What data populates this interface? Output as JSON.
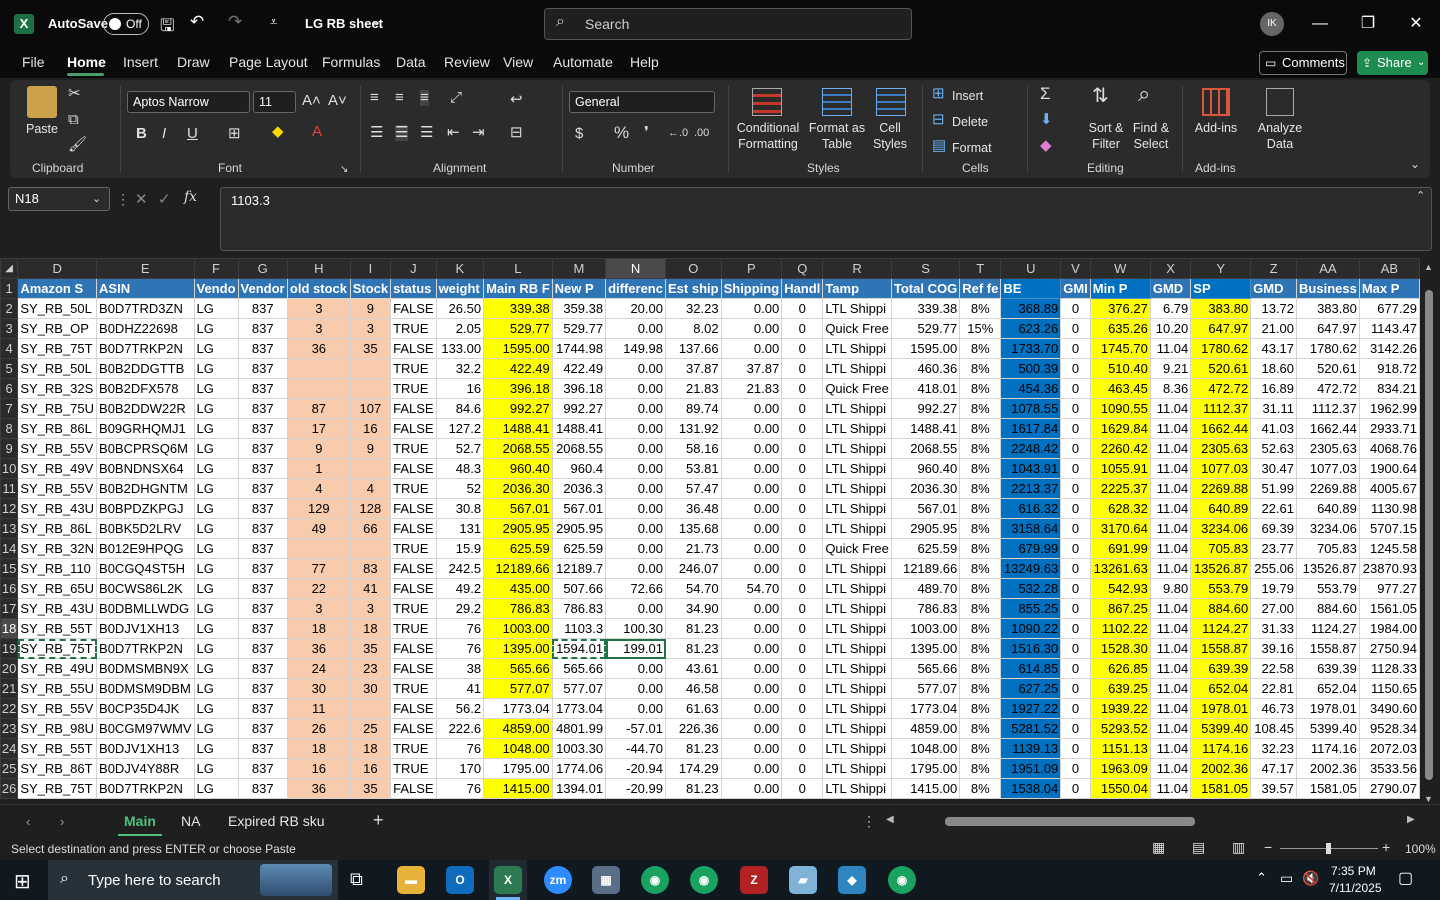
{
  "titlebar": {
    "app_icon": "excel-icon",
    "autosave_label": "AutoSave",
    "autosave_state": "Off",
    "file_name": "LG RB sheet",
    "search_placeholder": "Search",
    "avatar_initials": "IK"
  },
  "menu": [
    "File",
    "Home",
    "Insert",
    "Draw",
    "Page Layout",
    "Formulas",
    "Data",
    "Review",
    "View",
    "Automate",
    "Help"
  ],
  "menu_active": "Home",
  "buttons": {
    "comments": "Comments",
    "share": "Share"
  },
  "ribbon": {
    "clipboard": {
      "paste": "Paste",
      "label": "Clipboard"
    },
    "font": {
      "name": "Aptos Narrow",
      "size": "11",
      "label": "Font",
      "bold": "B",
      "italic": "I",
      "underline": "U"
    },
    "alignment": {
      "label": "Alignment"
    },
    "number": {
      "format": "General",
      "label": "Number",
      "currency": "$",
      "percent": "%"
    },
    "styles": {
      "conditional": "Conditional Formatting",
      "format_as_table": "Format as Table",
      "cell_styles": "Cell Styles",
      "label": "Styles"
    },
    "cells": {
      "insert": "Insert",
      "delete": "Delete",
      "format": "Format",
      "label": "Cells"
    },
    "editing": {
      "sort_filter": "Sort & Filter",
      "find_select": "Find & Select",
      "label": "Editing"
    },
    "addins": {
      "addins": "Add-ins",
      "analyze": "Analyze Data",
      "label": "Add-ins"
    }
  },
  "formula_bar": {
    "name_box": "N18",
    "fx": "fx",
    "value": "1103.3"
  },
  "columns": [
    "D",
    "E",
    "F",
    "G",
    "H",
    "I",
    "J",
    "K",
    "L",
    "M",
    "N",
    "O",
    "P",
    "Q",
    "R",
    "S",
    "T",
    "U",
    "V",
    "W",
    "X",
    "Y",
    "Z",
    "AA",
    "AB"
  ],
  "selected_column": "N",
  "header_row": [
    "Amazon S",
    "ASIN",
    "Vendo",
    "Vendor",
    "old stock",
    "Stock",
    "status",
    "weight",
    "Main RB F",
    "New P",
    "differenc",
    "Est ship",
    "Shipping",
    "Handl",
    "Tamp",
    "Total COG",
    "Ref fe",
    "BE",
    "GMI",
    "Min P",
    "GMD",
    "SP",
    "GMD",
    "Business",
    "Max P"
  ],
  "rows": [
    [
      "SY_RB_50L",
      "B0D7TRD3ZN",
      "LG",
      "837",
      "3",
      "9",
      "FALSE",
      "26.50",
      "339.38",
      "359.38",
      "20.00",
      "32.23",
      "0.00",
      "0",
      "LTL Shippi",
      "339.38",
      "8%",
      "368.89",
      "0",
      "376.27",
      "6.79",
      "383.80",
      "13.72",
      "383.80",
      "677.29"
    ],
    [
      "SY_RB_OP",
      "B0DHZ22698",
      "LG",
      "837",
      "3",
      "3",
      "TRUE",
      "2.05",
      "529.77",
      "529.77",
      "0.00",
      "8.02",
      "0.00",
      "0",
      "Quick Free",
      "529.77",
      "15%",
      "623.26",
      "0",
      "635.26",
      "10.20",
      "647.97",
      "21.00",
      "647.97",
      "1143.47"
    ],
    [
      "SY_RB_75T",
      "B0D7TRKP2N",
      "LG",
      "837",
      "36",
      "35",
      "FALSE",
      "133.00",
      "1595.00",
      "1744.98",
      "149.98",
      "137.66",
      "0.00",
      "0",
      "LTL Shippi",
      "1595.00",
      "8%",
      "1733.70",
      "0",
      "1745.70",
      "11.04",
      "1780.62",
      "43.17",
      "1780.62",
      "3142.26"
    ],
    [
      "SY_RB_50L",
      "B0B2DDGTTB",
      "LG",
      "837",
      "",
      "",
      "TRUE",
      "32.2",
      "422.49",
      "422.49",
      "0.00",
      "37.87",
      "37.87",
      "0",
      "LTL Shippi",
      "460.36",
      "8%",
      "500.39",
      "0",
      "510.40",
      "9.21",
      "520.61",
      "18.60",
      "520.61",
      "918.72"
    ],
    [
      "SY_RB_32S",
      "B0B2DFX578",
      "LG",
      "837",
      "",
      "",
      "TRUE",
      "16",
      "396.18",
      "396.18",
      "0.00",
      "21.83",
      "21.83",
      "0",
      "Quick Free",
      "418.01",
      "8%",
      "454.36",
      "0",
      "463.45",
      "8.36",
      "472.72",
      "16.89",
      "472.72",
      "834.21"
    ],
    [
      "SY_RB_75U",
      "B0B2DDW22R",
      "LG",
      "837",
      "87",
      "107",
      "FALSE",
      "84.6",
      "992.27",
      "992.27",
      "0.00",
      "89.74",
      "0.00",
      "0",
      "LTL Shippi",
      "992.27",
      "8%",
      "1078.55",
      "0",
      "1090.55",
      "11.04",
      "1112.37",
      "31.11",
      "1112.37",
      "1962.99"
    ],
    [
      "SY_RB_86L",
      "B09GRHQMJ1",
      "LG",
      "837",
      "17",
      "16",
      "FALSE",
      "127.2",
      "1488.41",
      "1488.41",
      "0.00",
      "131.92",
      "0.00",
      "0",
      "LTL Shippi",
      "1488.41",
      "8%",
      "1617.84",
      "0",
      "1629.84",
      "11.04",
      "1662.44",
      "41.03",
      "1662.44",
      "2933.71"
    ],
    [
      "SY_RB_55V",
      "B0BCPRSQ6M",
      "LG",
      "837",
      "9",
      "9",
      "TRUE",
      "52.7",
      "2068.55",
      "2068.55",
      "0.00",
      "58.16",
      "0.00",
      "0",
      "LTL Shippi",
      "2068.55",
      "8%",
      "2248.42",
      "0",
      "2260.42",
      "11.04",
      "2305.63",
      "52.63",
      "2305.63",
      "4068.76"
    ],
    [
      "SY_RB_49V",
      "B0BNDNSX64",
      "LG",
      "837",
      "1",
      "",
      "FALSE",
      "48.3",
      "960.40",
      "960.4",
      "0.00",
      "53.81",
      "0.00",
      "0",
      "LTL Shippi",
      "960.40",
      "8%",
      "1043.91",
      "0",
      "1055.91",
      "11.04",
      "1077.03",
      "30.47",
      "1077.03",
      "1900.64"
    ],
    [
      "SY_RB_55V",
      "B0B2DHGNTM",
      "LG",
      "837",
      "4",
      "4",
      "TRUE",
      "52",
      "2036.30",
      "2036.3",
      "0.00",
      "57.47",
      "0.00",
      "0",
      "LTL Shippi",
      "2036.30",
      "8%",
      "2213.37",
      "0",
      "2225.37",
      "11.04",
      "2269.88",
      "51.99",
      "2269.88",
      "4005.67"
    ],
    [
      "SY_RB_43U",
      "B0BPDZKPGJ",
      "LG",
      "837",
      "129",
      "128",
      "FALSE",
      "30.8",
      "567.01",
      "567.01",
      "0.00",
      "36.48",
      "0.00",
      "0",
      "LTL Shippi",
      "567.01",
      "8%",
      "616.32",
      "0",
      "628.32",
      "11.04",
      "640.89",
      "22.61",
      "640.89",
      "1130.98"
    ],
    [
      "SY_RB_86L",
      "B0BK5D2LRV",
      "LG",
      "837",
      "49",
      "66",
      "FALSE",
      "131",
      "2905.95",
      "2905.95",
      "0.00",
      "135.68",
      "0.00",
      "0",
      "LTL Shippi",
      "2905.95",
      "8%",
      "3158.64",
      "0",
      "3170.64",
      "11.04",
      "3234.06",
      "69.39",
      "3234.06",
      "5707.15"
    ],
    [
      "SY_RB_32N",
      "B012E9HPQG",
      "LG",
      "837",
      "",
      "",
      "TRUE",
      "15.9",
      "625.59",
      "625.59",
      "0.00",
      "21.73",
      "0.00",
      "0",
      "Quick Free",
      "625.59",
      "8%",
      "679.99",
      "0",
      "691.99",
      "11.04",
      "705.83",
      "23.77",
      "705.83",
      "1245.58"
    ],
    [
      "SY_RB_110",
      "B0CGQ4ST5H",
      "LG",
      "837",
      "77",
      "83",
      "FALSE",
      "242.5",
      "12189.66",
      "12189.7",
      "0.00",
      "246.07",
      "0.00",
      "0",
      "LTL Shippi",
      "12189.66",
      "8%",
      "13249.63",
      "0",
      "13261.63",
      "11.04",
      "13526.87",
      "255.06",
      "13526.87",
      "23870.93"
    ],
    [
      "SY_RB_65U",
      "B0CWS86L2K",
      "LG",
      "837",
      "22",
      "41",
      "FALSE",
      "49.2",
      "435.00",
      "507.66",
      "72.66",
      "54.70",
      "54.70",
      "0",
      "LTL Shippi",
      "489.70",
      "8%",
      "532.28",
      "0",
      "542.93",
      "9.80",
      "553.79",
      "19.79",
      "553.79",
      "977.27"
    ],
    [
      "SY_RB_43U",
      "B0DBMLLWDG",
      "LG",
      "837",
      "3",
      "3",
      "TRUE",
      "29.2",
      "786.83",
      "786.83",
      "0.00",
      "34.90",
      "0.00",
      "0",
      "LTL Shippi",
      "786.83",
      "8%",
      "855.25",
      "0",
      "867.25",
      "11.04",
      "884.60",
      "27.00",
      "884.60",
      "1561.05"
    ],
    [
      "SY_RB_55T",
      "B0DJV1XH13",
      "LG",
      "837",
      "18",
      "18",
      "TRUE",
      "76",
      "1003.00",
      "1103.3",
      "100.30",
      "81.23",
      "0.00",
      "0",
      "LTL Shippi",
      "1003.00",
      "8%",
      "1090.22",
      "0",
      "1102.22",
      "11.04",
      "1124.27",
      "31.33",
      "1124.27",
      "1984.00"
    ],
    [
      "SY_RB_75T",
      "B0D7TRKP2N",
      "LG",
      "837",
      "36",
      "35",
      "FALSE",
      "76",
      "1395.00",
      "1594.01",
      "199.01",
      "81.23",
      "0.00",
      "0",
      "LTL Shippi",
      "1395.00",
      "8%",
      "1516.30",
      "0",
      "1528.30",
      "11.04",
      "1558.87",
      "39.16",
      "1558.87",
      "2750.94"
    ],
    [
      "SY_RB_49U",
      "B0DMSMBN9X",
      "LG",
      "837",
      "24",
      "23",
      "FALSE",
      "38",
      "565.66",
      "565.66",
      "0.00",
      "43.61",
      "0.00",
      "0",
      "LTL Shippi",
      "565.66",
      "8%",
      "614.85",
      "0",
      "626.85",
      "11.04",
      "639.39",
      "22.58",
      "639.39",
      "1128.33"
    ],
    [
      "SY_RB_55U",
      "B0DMSM9DBM",
      "LG",
      "837",
      "30",
      "30",
      "TRUE",
      "41",
      "577.07",
      "577.07",
      "0.00",
      "46.58",
      "0.00",
      "0",
      "LTL Shippi",
      "577.07",
      "8%",
      "627.25",
      "0",
      "639.25",
      "11.04",
      "652.04",
      "22.81",
      "652.04",
      "1150.65"
    ],
    [
      "SY_RB_55V",
      "B0CP35D4JK",
      "LG",
      "837",
      "11",
      "",
      "FALSE",
      "56.2",
      "1773.04",
      "1773.04",
      "0.00",
      "61.63",
      "0.00",
      "0",
      "LTL Shippi",
      "1773.04",
      "8%",
      "1927.22",
      "0",
      "1939.22",
      "11.04",
      "1978.01",
      "46.73",
      "1978.01",
      "3490.60"
    ],
    [
      "SY_RB_98U",
      "B0CGM97WMV",
      "LG",
      "837",
      "26",
      "25",
      "FALSE",
      "222.6",
      "4859.00",
      "4801.99",
      "-57.01",
      "226.36",
      "0.00",
      "0",
      "LTL Shippi",
      "4859.00",
      "8%",
      "5281.52",
      "0",
      "5293.52",
      "11.04",
      "5399.40",
      "108.45",
      "5399.40",
      "9528.34"
    ],
    [
      "SY_RB_55T",
      "B0DJV1XH13",
      "LG",
      "837",
      "18",
      "18",
      "TRUE",
      "76",
      "1048.00",
      "1003.30",
      "-44.70",
      "81.23",
      "0.00",
      "0",
      "LTL Shippi",
      "1048.00",
      "8%",
      "1139.13",
      "0",
      "1151.13",
      "11.04",
      "1174.16",
      "32.23",
      "1174.16",
      "2072.03"
    ],
    [
      "SY_RB_86T",
      "B0DJV4Y88R",
      "LG",
      "837",
      "16",
      "16",
      "TRUE",
      "170",
      "1795.00",
      "1774.06",
      "-20.94",
      "174.29",
      "0.00",
      "0",
      "LTL Shippi",
      "1795.00",
      "8%",
      "1951.09",
      "0",
      "1963.09",
      "11.04",
      "2002.36",
      "47.17",
      "2002.36",
      "3533.56"
    ],
    [
      "SY_RB_75T",
      "B0D7TRKP2N",
      "LG",
      "837",
      "36",
      "35",
      "FALSE",
      "76",
      "1415.00",
      "1394.01",
      "-20.99",
      "81.23",
      "0.00",
      "0",
      "LTL Shippi",
      "1415.00",
      "8%",
      "1538.04",
      "0",
      "1550.04",
      "11.04",
      "1581.05",
      "39.57",
      "1581.05",
      "2790.07"
    ]
  ],
  "sheet_tabs": [
    "Main",
    "NA",
    "Expired RB sku"
  ],
  "active_sheet": "Main",
  "status_text": "Select destination and press ENTER or choose Paste",
  "zoom": "100%",
  "taskbar": {
    "search_placeholder": "Type here to search",
    "time": "7:35 PM",
    "date": "7/11/2025"
  }
}
